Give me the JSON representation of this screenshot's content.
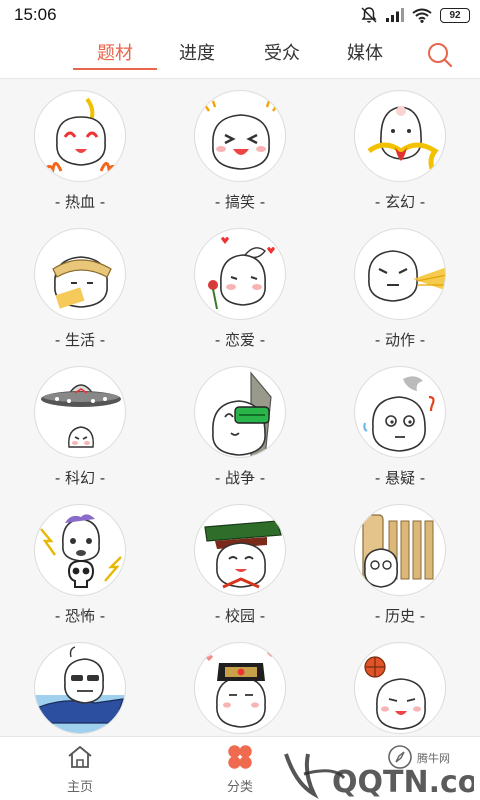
{
  "status": {
    "time": "15:06",
    "battery": "92"
  },
  "tabs": [
    {
      "label": "题材",
      "active": true
    },
    {
      "label": "进度",
      "active": false
    },
    {
      "label": "受众",
      "active": false
    },
    {
      "label": "媒体",
      "active": false
    }
  ],
  "categories": [
    {
      "label": "- 热血 -",
      "icon": "hot-blood-bun-icon"
    },
    {
      "label": "- 搞笑 -",
      "icon": "funny-bun-icon"
    },
    {
      "label": "- 玄幻 -",
      "icon": "fantasy-bun-icon"
    },
    {
      "label": "- 生活 -",
      "icon": "life-bun-icon"
    },
    {
      "label": "- 恋爱 -",
      "icon": "romance-bun-icon"
    },
    {
      "label": "- 动作 -",
      "icon": "action-bun-icon"
    },
    {
      "label": "- 科幻 -",
      "icon": "scifi-ufo-bun-icon"
    },
    {
      "label": "- 战争 -",
      "icon": "war-bun-icon"
    },
    {
      "label": "- 悬疑 -",
      "icon": "suspense-bun-icon"
    },
    {
      "label": "- 恐怖 -",
      "icon": "horror-skull-bun-icon"
    },
    {
      "label": "- 校园 -",
      "icon": "campus-bun-icon"
    },
    {
      "label": "- 历史 -",
      "icon": "history-bun-icon"
    },
    {
      "label": "",
      "icon": "boat-bun-icon"
    },
    {
      "label": "",
      "icon": "palace-bun-icon"
    },
    {
      "label": "",
      "icon": "sports-bun-icon"
    }
  ],
  "bottom_nav": [
    {
      "label": "主页",
      "icon": "home-icon"
    },
    {
      "label": "分类",
      "icon": "category-clover-icon"
    },
    {
      "label": "",
      "icon": "discover-icon"
    }
  ],
  "watermark": {
    "text": "腾牛网",
    "logo": "QQTN.com"
  },
  "colors": {
    "accent": "#e8664b",
    "background": "#f6f6f6"
  }
}
